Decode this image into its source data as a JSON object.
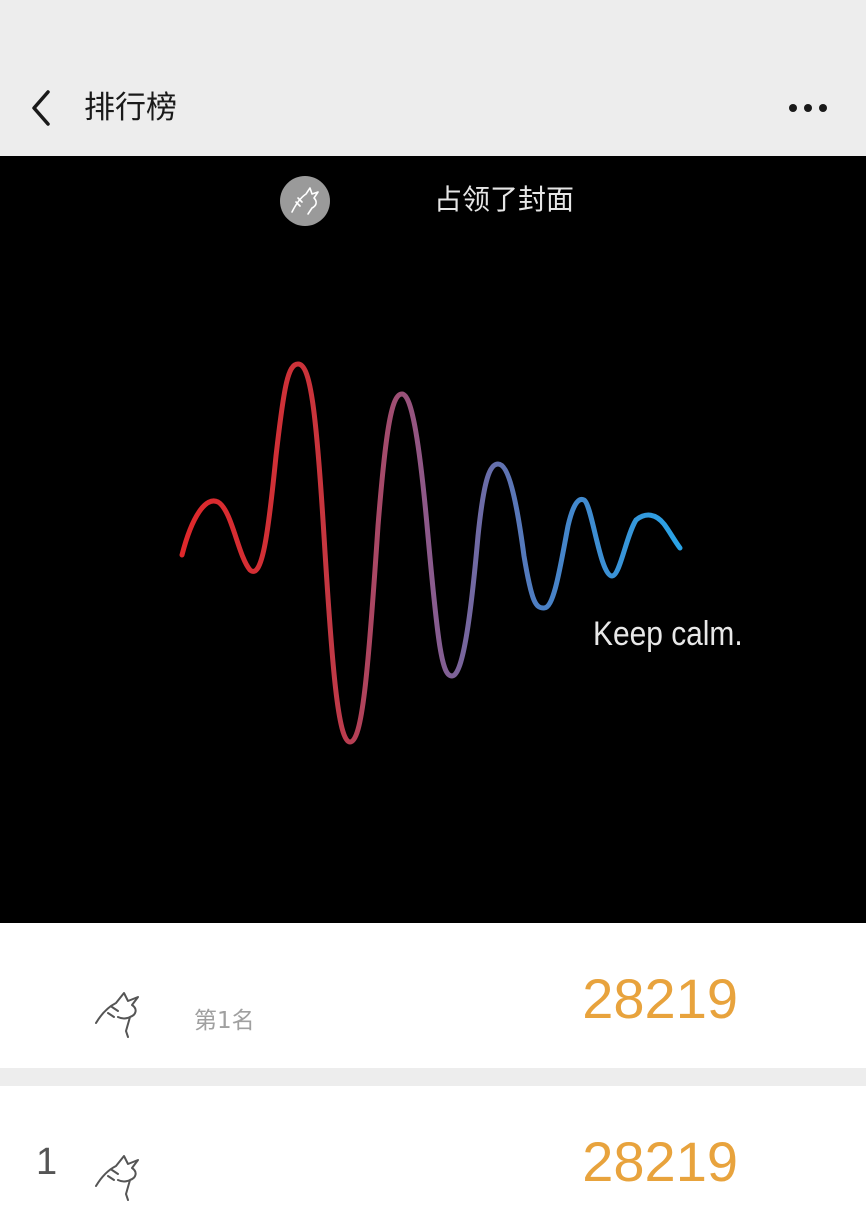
{
  "navbar": {
    "title": "排行榜",
    "back_icon": "chevron-left-icon",
    "more_icon": "more-horizontal-icon"
  },
  "cover": {
    "caption": "占领了封面",
    "tagline": "Keep calm.",
    "wave_color_start": "#e0282b",
    "wave_color_end": "#2aa3e6"
  },
  "my_rank": {
    "label": "第1名",
    "score": "28219"
  },
  "ranking": [
    {
      "rank": "1",
      "score": "28219"
    }
  ],
  "colors": {
    "score": "#e8a33d",
    "background": "#ededed"
  }
}
